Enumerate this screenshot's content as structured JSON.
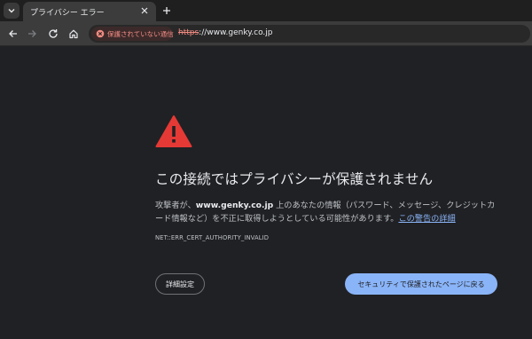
{
  "tab": {
    "title": "プライバシー エラー",
    "close_icon": "close-icon",
    "menu_icon": "chevron-down-icon"
  },
  "new_tab_icon": "plus-icon",
  "toolbar": {
    "back_icon": "arrow-left-icon",
    "forward_icon": "arrow-right-icon",
    "reload_icon": "reload-icon",
    "home_icon": "home-icon",
    "security_label": "保護されていない通信",
    "url_scheme": "https",
    "url_rest": "://www.genky.co.jp"
  },
  "colors": {
    "background": "#202124",
    "warning_red": "#e53935",
    "link_blue": "#8ab4f8",
    "insecure_red": "#f28b82"
  },
  "content": {
    "warning_icon": "warning-triangle-icon",
    "heading": "この接続ではプライバシーが保護されません",
    "body_prefix": "攻撃者が、",
    "body_domain": "www.genky.co.jp",
    "body_middle": " 上のあなたの情報（パスワード、メッセージ、クレジットカード情報など）を不正に取得しようとしている可能性があります。",
    "body_link": "この警告の詳細",
    "error_code": "NET::ERR_CERT_AUTHORITY_INVALID",
    "advanced_button": "詳細設定",
    "back_button": "セキュリティで保護されたページに戻る"
  }
}
